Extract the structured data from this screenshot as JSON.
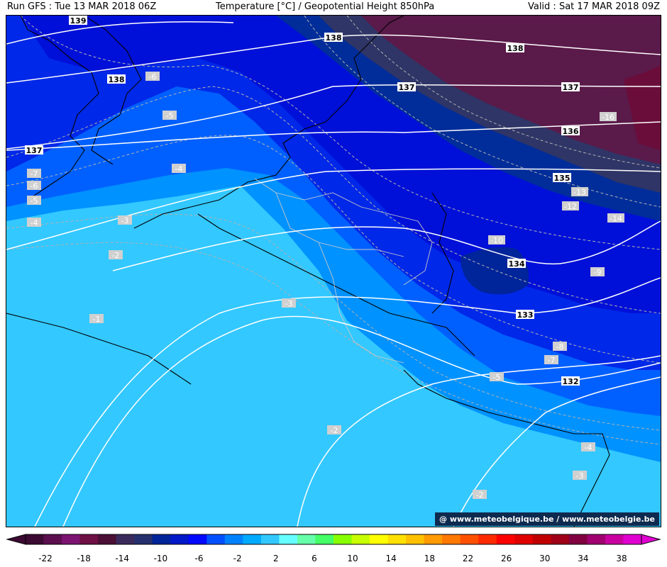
{
  "header": {
    "run": "Run GFS : Tue 13 MAR 2018 06Z",
    "title": "Temperature [°C] / Geopotential Height 850hPa",
    "valid": "Valid : Sat 17 MAR 2018 09Z"
  },
  "credit": "@ www.meteobelgique.be / www.meteobelgie.be",
  "colors": {
    "t_le_-16": "#5a1a4a",
    "t_-16_-14": "#2f3566",
    "t_-14_-12": "#002d9a",
    "t_-12_-8": "#0010d8",
    "t_-8_-6": "#0028e8",
    "t_-6_-4": "#0060ff",
    "t_-4_-2": "#0092ff",
    "t_-2_0": "#33c8ff",
    "height_line": "#ffffff",
    "temp_line": "#b0b0b0",
    "border": "#000000"
  },
  "height_contours": [
    "139",
    "138",
    "137",
    "136",
    "135",
    "134",
    "133",
    "132"
  ],
  "temperature_contour_labels": [
    "-16",
    "-14",
    "-13",
    "-12",
    "-10",
    "-9",
    "-8",
    "-7",
    "-6",
    "-5",
    "-4",
    "-3",
    "-2",
    "-1"
  ],
  "legend": {
    "ticks": [
      "-22",
      "-18",
      "-14",
      "-10",
      "-6",
      "-2",
      "2",
      "6",
      "10",
      "14",
      "18",
      "22",
      "26",
      "30",
      "34",
      "38"
    ],
    "colors": [
      "#3d0a33",
      "#5c0f4f",
      "#7d1472",
      "#6e1043",
      "#4b0f36",
      "#3a2a5c",
      "#26306e",
      "#00249a",
      "#0018c8",
      "#0008ff",
      "#0050ff",
      "#0082ff",
      "#00aaff",
      "#33c8ff",
      "#66ffff",
      "#66ffaa",
      "#44ff66",
      "#88ff00",
      "#c8ff00",
      "#ffff00",
      "#ffe000",
      "#ffc000",
      "#ff9a00",
      "#ff7800",
      "#ff5000",
      "#ff2a00",
      "#ff0000",
      "#e00000",
      "#c00000",
      "#a00018",
      "#800040",
      "#a00070",
      "#c800a0",
      "#e000d0"
    ]
  }
}
